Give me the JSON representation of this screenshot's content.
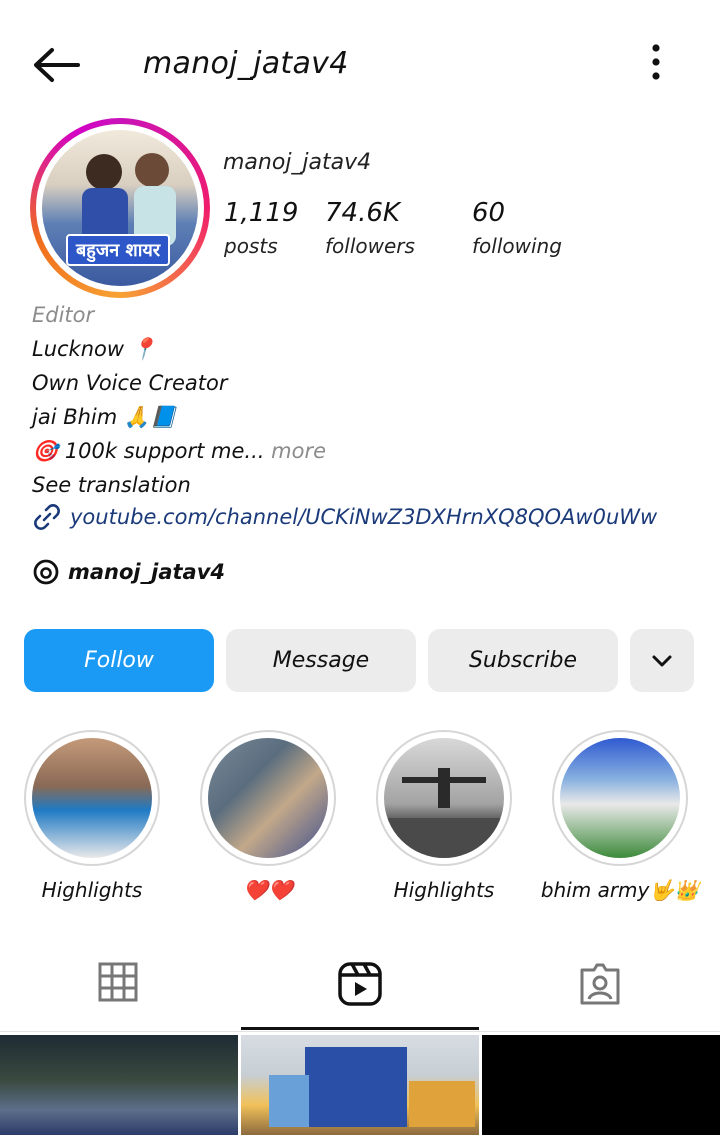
{
  "header": {
    "title": "manoj_jatav4",
    "back_icon": "arrow-left-icon",
    "more_icon": "vertical-dots-icon"
  },
  "profile": {
    "name": "manoj_jatav4",
    "avatar_badge": "बहुजन शायर",
    "stats": [
      {
        "value": "1,119",
        "label": "posts"
      },
      {
        "value": "74.6K",
        "label": "followers"
      },
      {
        "value": "60",
        "label": "following"
      }
    ]
  },
  "bio": {
    "category": "Editor",
    "line1": "Lucknow 📍",
    "line2": "Own Voice Creator",
    "line3": "jai Bhim 🙏📘",
    "line4": "🎯 100k support me...",
    "more": "more",
    "translation": "See translation",
    "link": "youtube.com/channel/UCKiNwZ3DXHrnXQ8QOAw0uWw",
    "link_icon": "link-icon",
    "threads_handle": "manoj_jatav4",
    "threads_icon": "threads-icon"
  },
  "actions": {
    "follow": "Follow",
    "message": "Message",
    "subscribe": "Subscribe",
    "dropdown_icon": "chevron-down-icon"
  },
  "highlights": [
    {
      "label": "Highlights"
    },
    {
      "label": "❤️❤️"
    },
    {
      "label": "Highlights"
    },
    {
      "label": "bhim army🤟👑"
    }
  ],
  "tabs": {
    "icons": [
      "grid-icon",
      "reels-icon",
      "tagged-icon"
    ],
    "active": "reels-icon"
  },
  "colors": {
    "follow_button": "#1a9af5",
    "secondary_button": "#ececec",
    "link": "#1b3a7a",
    "muted_text": "#8c8c8c"
  }
}
